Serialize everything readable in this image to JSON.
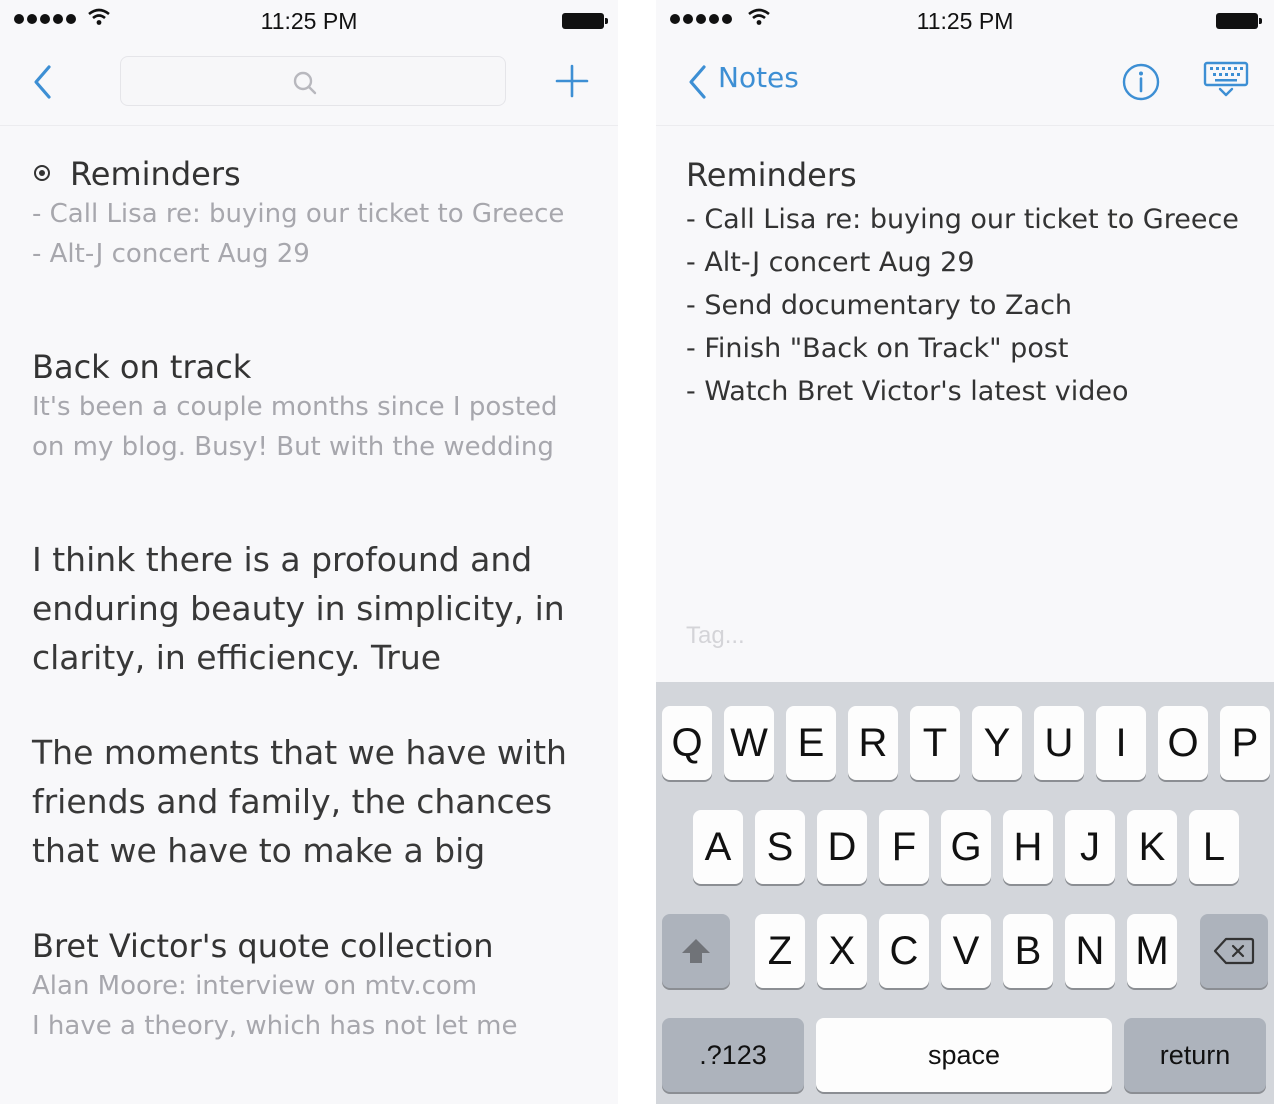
{
  "status_bar": {
    "time": "11:25 PM"
  },
  "notes_list": {
    "search": {
      "placeholder": ""
    },
    "notes": [
      {
        "title": "Reminders",
        "pinned": true,
        "preview": [
          "- Call Lisa re: buying our ticket to Greece",
          "- Alt-J concert Aug 29"
        ]
      },
      {
        "title": "Back on track",
        "preview": [
          "It's been a couple months since I posted",
          "on my blog. Busy! But with the wedding"
        ]
      },
      {
        "body": [
          "I think there is a profound and",
          "enduring beauty in simplicity, in",
          "clarity, in efficiency. True"
        ]
      },
      {
        "body": [
          "The moments that we have with",
          "friends and family, the chances",
          "that we have to make a big"
        ]
      },
      {
        "title": "Bret Victor's quote collection",
        "preview": [
          "Alan Moore: interview on mtv.com",
          "I have a theory, which has not let me"
        ]
      }
    ]
  },
  "editor": {
    "back_label": "Notes",
    "title": "Reminders",
    "lines": [
      "- Call Lisa re: buying our ticket to Greece",
      "- Alt-J concert Aug 29",
      "- Send documentary to Zach",
      "- Finish \"Back on Track\" post",
      "- Watch Bret Victor's latest video"
    ],
    "tag_placeholder": "Tag..."
  },
  "keyboard": {
    "row1": [
      "Q",
      "W",
      "E",
      "R",
      "T",
      "Y",
      "U",
      "I",
      "O",
      "P"
    ],
    "row2": [
      "A",
      "S",
      "D",
      "F",
      "G",
      "H",
      "J",
      "K",
      "L"
    ],
    "row3": [
      "Z",
      "X",
      "C",
      "V",
      "B",
      "N",
      "M"
    ],
    "numbers_label": ".?123",
    "space_label": "space",
    "return_label": "return"
  },
  "colors": {
    "accent": "#3d8fd4",
    "background": "#f8f8fa",
    "keyboard": "#d3d6db"
  }
}
